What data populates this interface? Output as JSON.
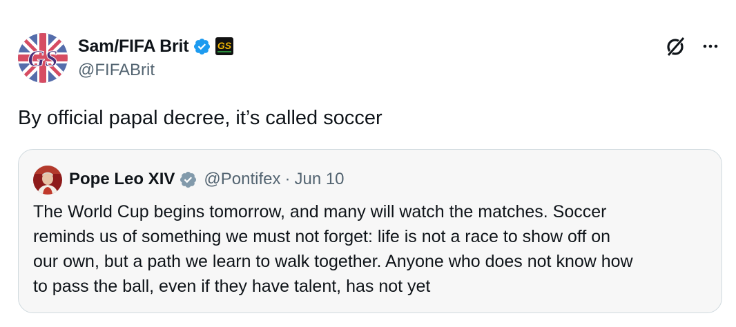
{
  "tweet": {
    "author": {
      "display_name": "Sam/FIFA Brit",
      "handle": "@FIFABrit",
      "verified": true,
      "affiliate_badge_icon": "gaming-affiliate-badge-icon",
      "avatar_colors": {
        "blue": "#1d3c8f",
        "red": "#c8102e",
        "white": "#ffffff"
      }
    },
    "text": "By official papal decree, it’s called soccer",
    "actions": {
      "grok_icon": "grok-icon",
      "more_icon": "more-dots-icon"
    },
    "quoted": {
      "author": {
        "display_name": "Pope Leo XIV",
        "handle": "@Pontifex",
        "verified": true,
        "verified_color": "#829aab"
      },
      "separator": "·",
      "date": "Jun 10",
      "lines": [
        "The World Cup begins tomorrow, and many will watch the matches. Soccer",
        "reminds us of something we must not forget: life is not a race to show off on",
        "our own, but a path we learn to walk together. Anyone who does not know how",
        "to pass the ball, even if they have talent, has not yet"
      ]
    }
  },
  "colors": {
    "text_primary": "#0f1419",
    "text_secondary": "#536471",
    "verified_blue": "#1d9bf0",
    "quote_border": "#cfd9de",
    "quote_background": "#f7f7f7"
  }
}
